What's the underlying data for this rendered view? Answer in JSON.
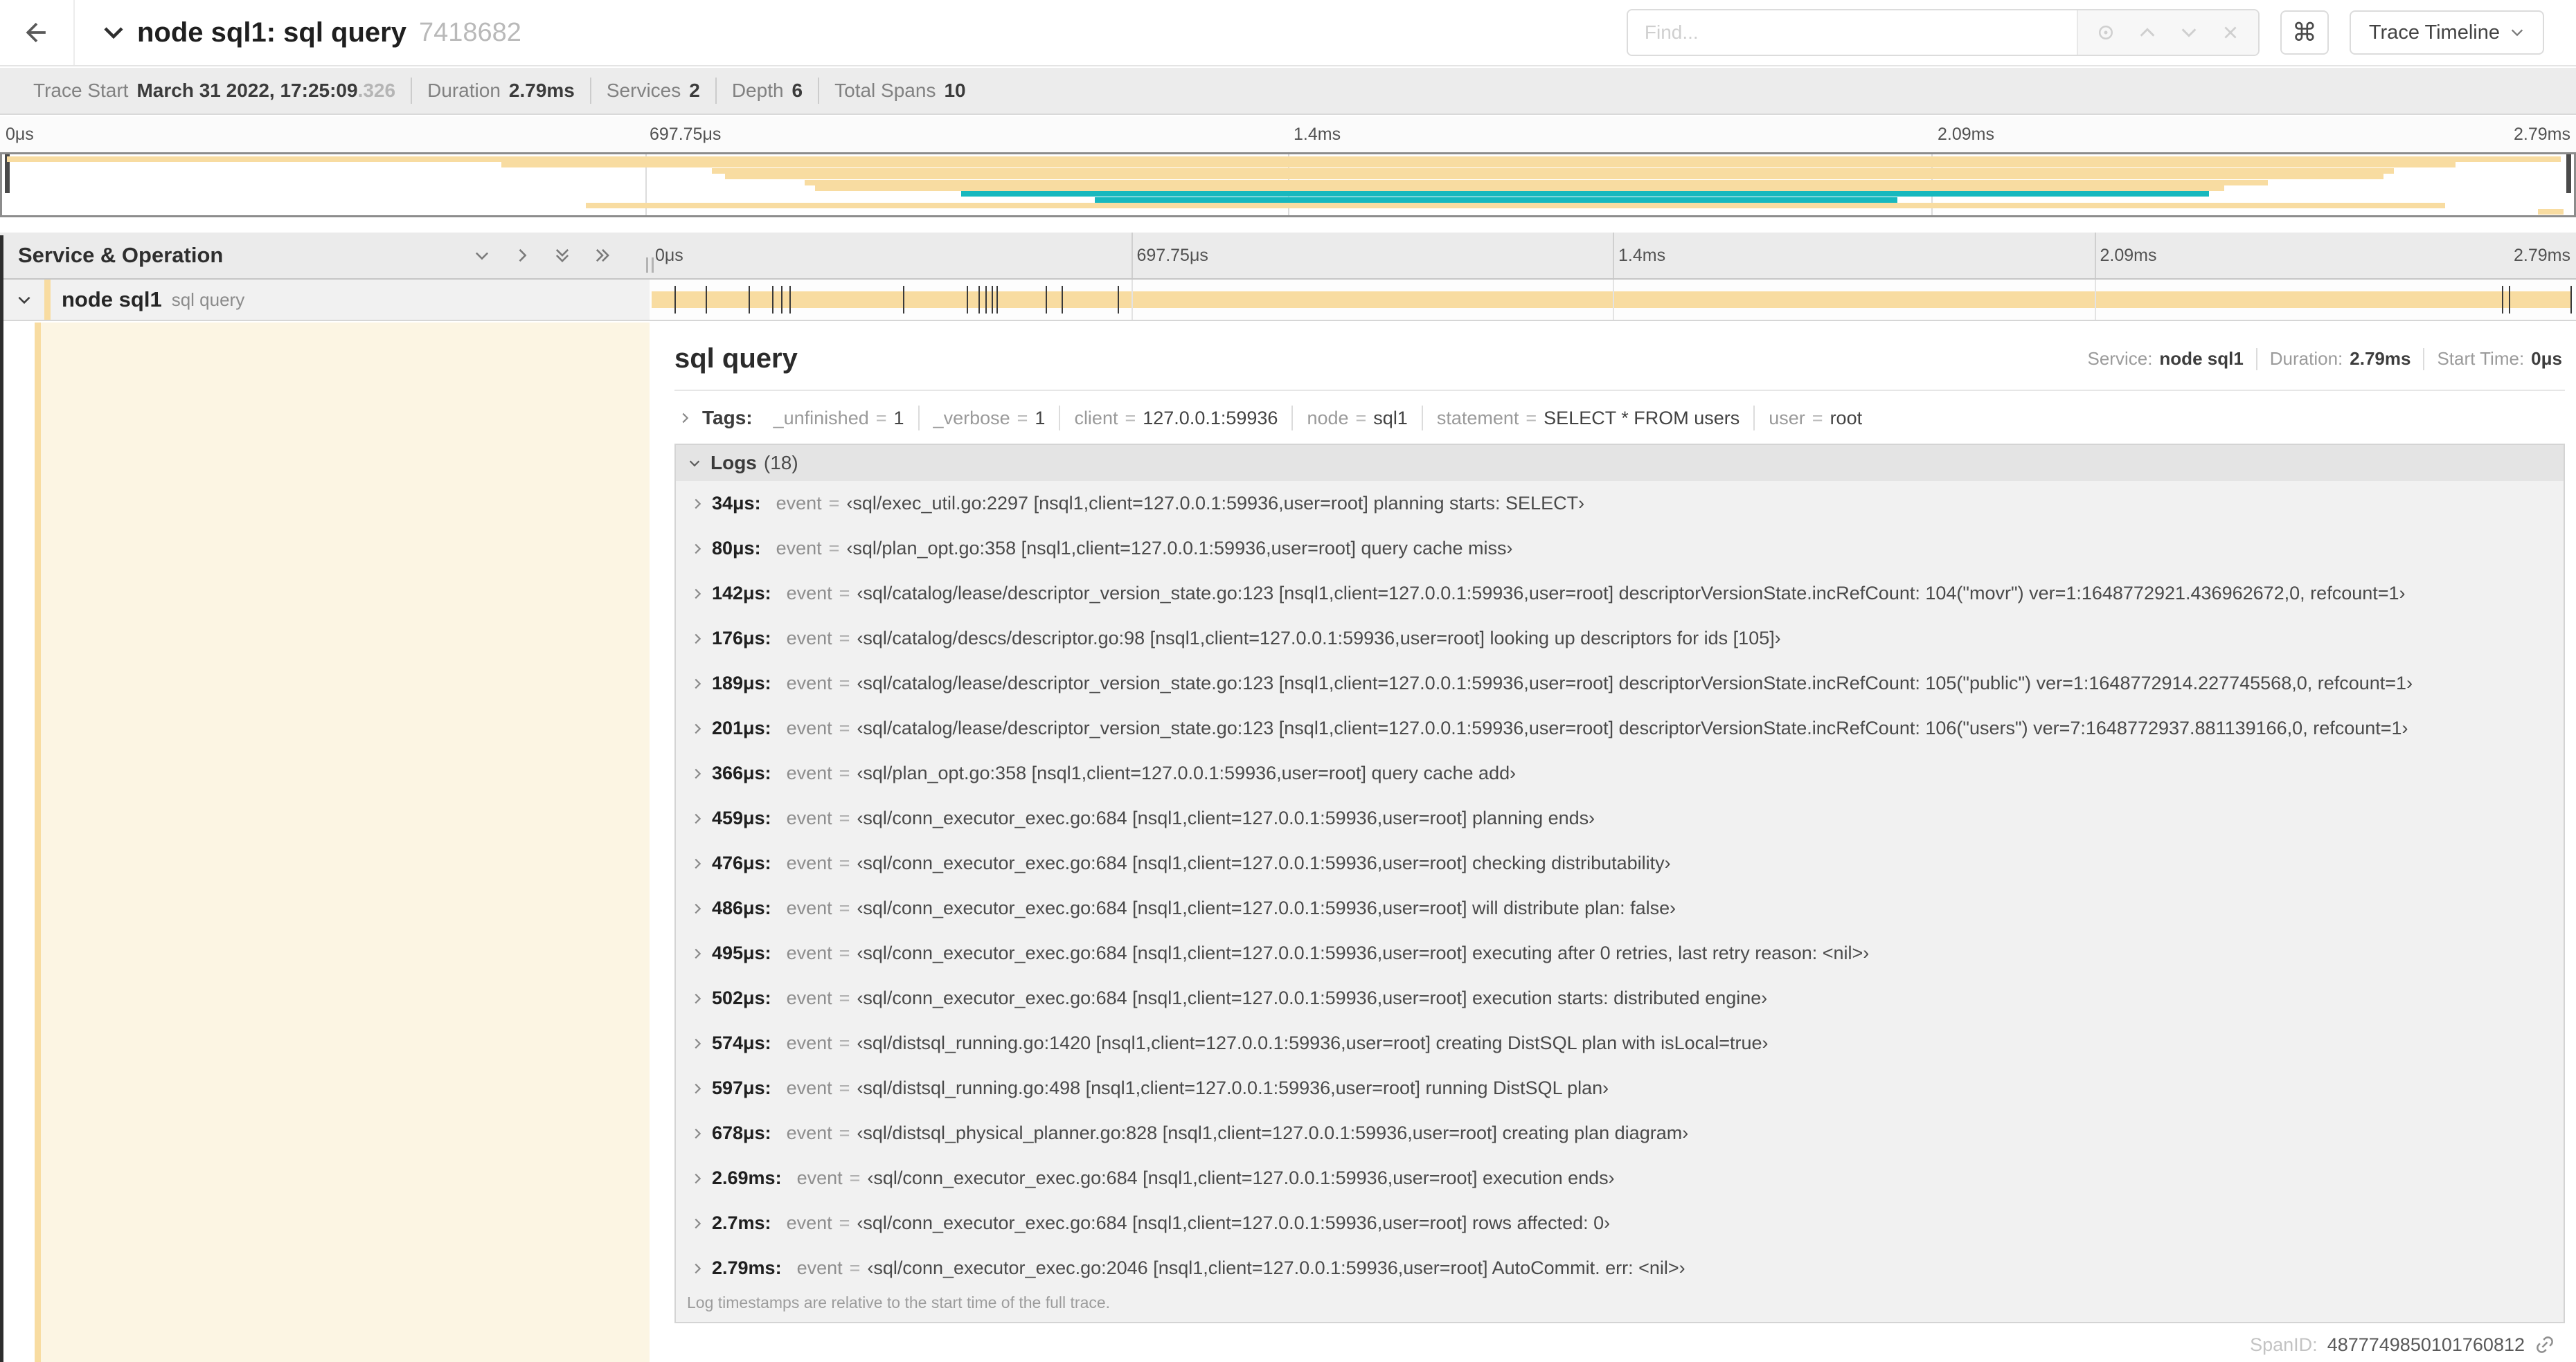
{
  "colors": {
    "wheat": "#F8DCA1",
    "teal": "#17B8BE",
    "cream": "#FCF5E3"
  },
  "header": {
    "title": "node sql1: sql query",
    "trace_id": "7418682",
    "find_placeholder": "Find...",
    "command_glyph": "⌘",
    "trace_timeline_label": "Trace Timeline"
  },
  "trace_info": {
    "items": [
      {
        "label": "Trace Start",
        "value": "March 31 2022, 17:25:09",
        "suffix": ".326"
      },
      {
        "label": "Duration",
        "value": "2.79ms"
      },
      {
        "label": "Services",
        "value": "2"
      },
      {
        "label": "Depth",
        "value": "6"
      },
      {
        "label": "Total Spans",
        "value": "10"
      }
    ]
  },
  "ruler_ticks": [
    {
      "label": "0μs",
      "pos": 0
    },
    {
      "label": "697.75μs",
      "pos": 25
    },
    {
      "label": "1.4ms",
      "pos": 50
    },
    {
      "label": "2.09ms",
      "pos": 75
    },
    {
      "label": "2.79ms",
      "pos": 100
    }
  ],
  "minimap": {
    "spans": [
      {
        "start": 0.002,
        "end": 0.995,
        "color": "wheat"
      },
      {
        "start": 0.194,
        "end": 0.954,
        "color": "wheat"
      },
      {
        "start": 0.276,
        "end": 0.93,
        "color": "wheat"
      },
      {
        "start": 0.281,
        "end": 0.926,
        "color": "wheat"
      },
      {
        "start": 0.312,
        "end": 0.881,
        "color": "wheat"
      },
      {
        "start": 0.316,
        "end": 0.864,
        "color": "wheat"
      },
      {
        "start": 0.373,
        "end": 0.858,
        "color": "teal"
      },
      {
        "start": 0.425,
        "end": 0.737,
        "color": "teal"
      },
      {
        "start": 0.227,
        "end": 0.95,
        "color": "wheat"
      },
      {
        "start": 0.986,
        "end": 0.996,
        "color": "wheat"
      }
    ]
  },
  "grid": {
    "column_header": "Service & Operation"
  },
  "span_row": {
    "service": "node sql1",
    "operation": "sql query"
  },
  "trace_total_us": 2790,
  "detail": {
    "title": "sql query",
    "overview": [
      {
        "label": "Service:",
        "value": "node sql1"
      },
      {
        "label": "Duration:",
        "value": "2.79ms"
      },
      {
        "label": "Start Time:",
        "value": "0μs"
      }
    ],
    "tags": {
      "label": "Tags:",
      "items": [
        {
          "key": "_unfinished",
          "value": "1"
        },
        {
          "key": "_verbose",
          "value": "1"
        },
        {
          "key": "client",
          "value": "127.0.0.1:59936"
        },
        {
          "key": "node",
          "value": "sql1"
        },
        {
          "key": "statement",
          "value": "SELECT * FROM users"
        },
        {
          "key": "user",
          "value": "root"
        }
      ]
    },
    "logs": {
      "label": "Logs",
      "count": "(18)",
      "entries": [
        {
          "time": "34μs:",
          "us": 34,
          "field": "event",
          "msg": "‹sql/exec_util.go:2297 [nsql1,client=127.0.0.1:59936,user=root] planning starts: SELECT›"
        },
        {
          "time": "80μs:",
          "us": 80,
          "field": "event",
          "msg": "‹sql/plan_opt.go:358 [nsql1,client=127.0.0.1:59936,user=root] query cache miss›"
        },
        {
          "time": "142μs:",
          "us": 142,
          "field": "event",
          "msg": "‹sql/catalog/lease/descriptor_version_state.go:123 [nsql1,client=127.0.0.1:59936,user=root] descriptorVersionState.incRefCount: 104(\"movr\") ver=1:1648772921.436962672,0, refcount=1›"
        },
        {
          "time": "176μs:",
          "us": 176,
          "field": "event",
          "msg": "‹sql/catalog/descs/descriptor.go:98 [nsql1,client=127.0.0.1:59936,user=root] looking up descriptors for ids [105]›"
        },
        {
          "time": "189μs:",
          "us": 189,
          "field": "event",
          "msg": "‹sql/catalog/lease/descriptor_version_state.go:123 [nsql1,client=127.0.0.1:59936,user=root] descriptorVersionState.incRefCount: 105(\"public\") ver=1:1648772914.227745568,0, refcount=1›"
        },
        {
          "time": "201μs:",
          "us": 201,
          "field": "event",
          "msg": "‹sql/catalog/lease/descriptor_version_state.go:123 [nsql1,client=127.0.0.1:59936,user=root] descriptorVersionState.incRefCount: 106(\"users\") ver=7:1648772937.881139166,0, refcount=1›"
        },
        {
          "time": "366μs:",
          "us": 366,
          "field": "event",
          "msg": "‹sql/plan_opt.go:358 [nsql1,client=127.0.0.1:59936,user=root] query cache add›"
        },
        {
          "time": "459μs:",
          "us": 459,
          "field": "event",
          "msg": "‹sql/conn_executor_exec.go:684 [nsql1,client=127.0.0.1:59936,user=root] planning ends›"
        },
        {
          "time": "476μs:",
          "us": 476,
          "field": "event",
          "msg": "‹sql/conn_executor_exec.go:684 [nsql1,client=127.0.0.1:59936,user=root] checking distributability›"
        },
        {
          "time": "486μs:",
          "us": 486,
          "field": "event",
          "msg": "‹sql/conn_executor_exec.go:684 [nsql1,client=127.0.0.1:59936,user=root] will distribute plan: false›"
        },
        {
          "time": "495μs:",
          "us": 495,
          "field": "event",
          "msg": "‹sql/conn_executor_exec.go:684 [nsql1,client=127.0.0.1:59936,user=root] executing after 0 retries, last retry reason: <nil>›"
        },
        {
          "time": "502μs:",
          "us": 502,
          "field": "event",
          "msg": "‹sql/conn_executor_exec.go:684 [nsql1,client=127.0.0.1:59936,user=root] execution starts: distributed engine›"
        },
        {
          "time": "574μs:",
          "us": 574,
          "field": "event",
          "msg": "‹sql/distsql_running.go:1420 [nsql1,client=127.0.0.1:59936,user=root] creating DistSQL plan with isLocal=true›"
        },
        {
          "time": "597μs:",
          "us": 597,
          "field": "event",
          "msg": "‹sql/distsql_running.go:498 [nsql1,client=127.0.0.1:59936,user=root] running DistSQL plan›"
        },
        {
          "time": "678μs:",
          "us": 678,
          "field": "event",
          "msg": "‹sql/distsql_physical_planner.go:828 [nsql1,client=127.0.0.1:59936,user=root] creating plan diagram›"
        },
        {
          "time": "2.69ms:",
          "us": 2690,
          "field": "event",
          "msg": "‹sql/conn_executor_exec.go:684 [nsql1,client=127.0.0.1:59936,user=root] execution ends›"
        },
        {
          "time": "2.7ms:",
          "us": 2700,
          "field": "event",
          "msg": "‹sql/conn_executor_exec.go:684 [nsql1,client=127.0.0.1:59936,user=root] rows affected: 0›"
        },
        {
          "time": "2.79ms:",
          "us": 2790,
          "field": "event",
          "msg": "‹sql/conn_executor_exec.go:2046 [nsql1,client=127.0.0.1:59936,user=root] AutoCommit. err: <nil>›"
        }
      ],
      "footer": "Log timestamps are relative to the start time of the full trace."
    },
    "span_id_label": "SpanID:",
    "span_id": "4877749850101760812"
  }
}
